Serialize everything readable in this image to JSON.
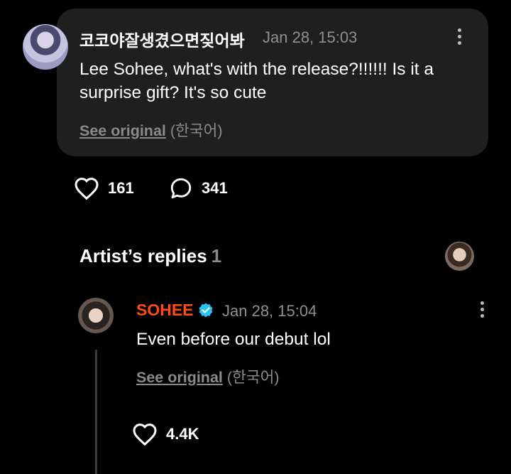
{
  "post": {
    "author": "코코야잘생겼으면짖어봐",
    "timestamp": "Jan 28, 15:03",
    "text": "Lee Sohee, what's with the release?!!!!!! Is it a surprise gift? It's so cute",
    "see_original": "See original",
    "original_language": "(한국어)",
    "like_count": "161",
    "comment_count": "341"
  },
  "artist_replies": {
    "heading": "Artist’s replies",
    "count": "1",
    "reply": {
      "author": "SOHEE",
      "timestamp": "Jan 28, 15:04",
      "text": "Even before our debut lol",
      "see_original": "See original",
      "original_language": "(한국어)",
      "like_count": "4.4K"
    }
  },
  "colors": {
    "background": "#000000",
    "card": "#1f1f1f",
    "artist_name": "#ff4b12",
    "verified_badge": "#27c4f0",
    "muted_text": "#8f8f8f"
  },
  "icons": [
    "more-vertical-icon",
    "heart-icon",
    "comment-icon",
    "verified-badge-icon"
  ]
}
